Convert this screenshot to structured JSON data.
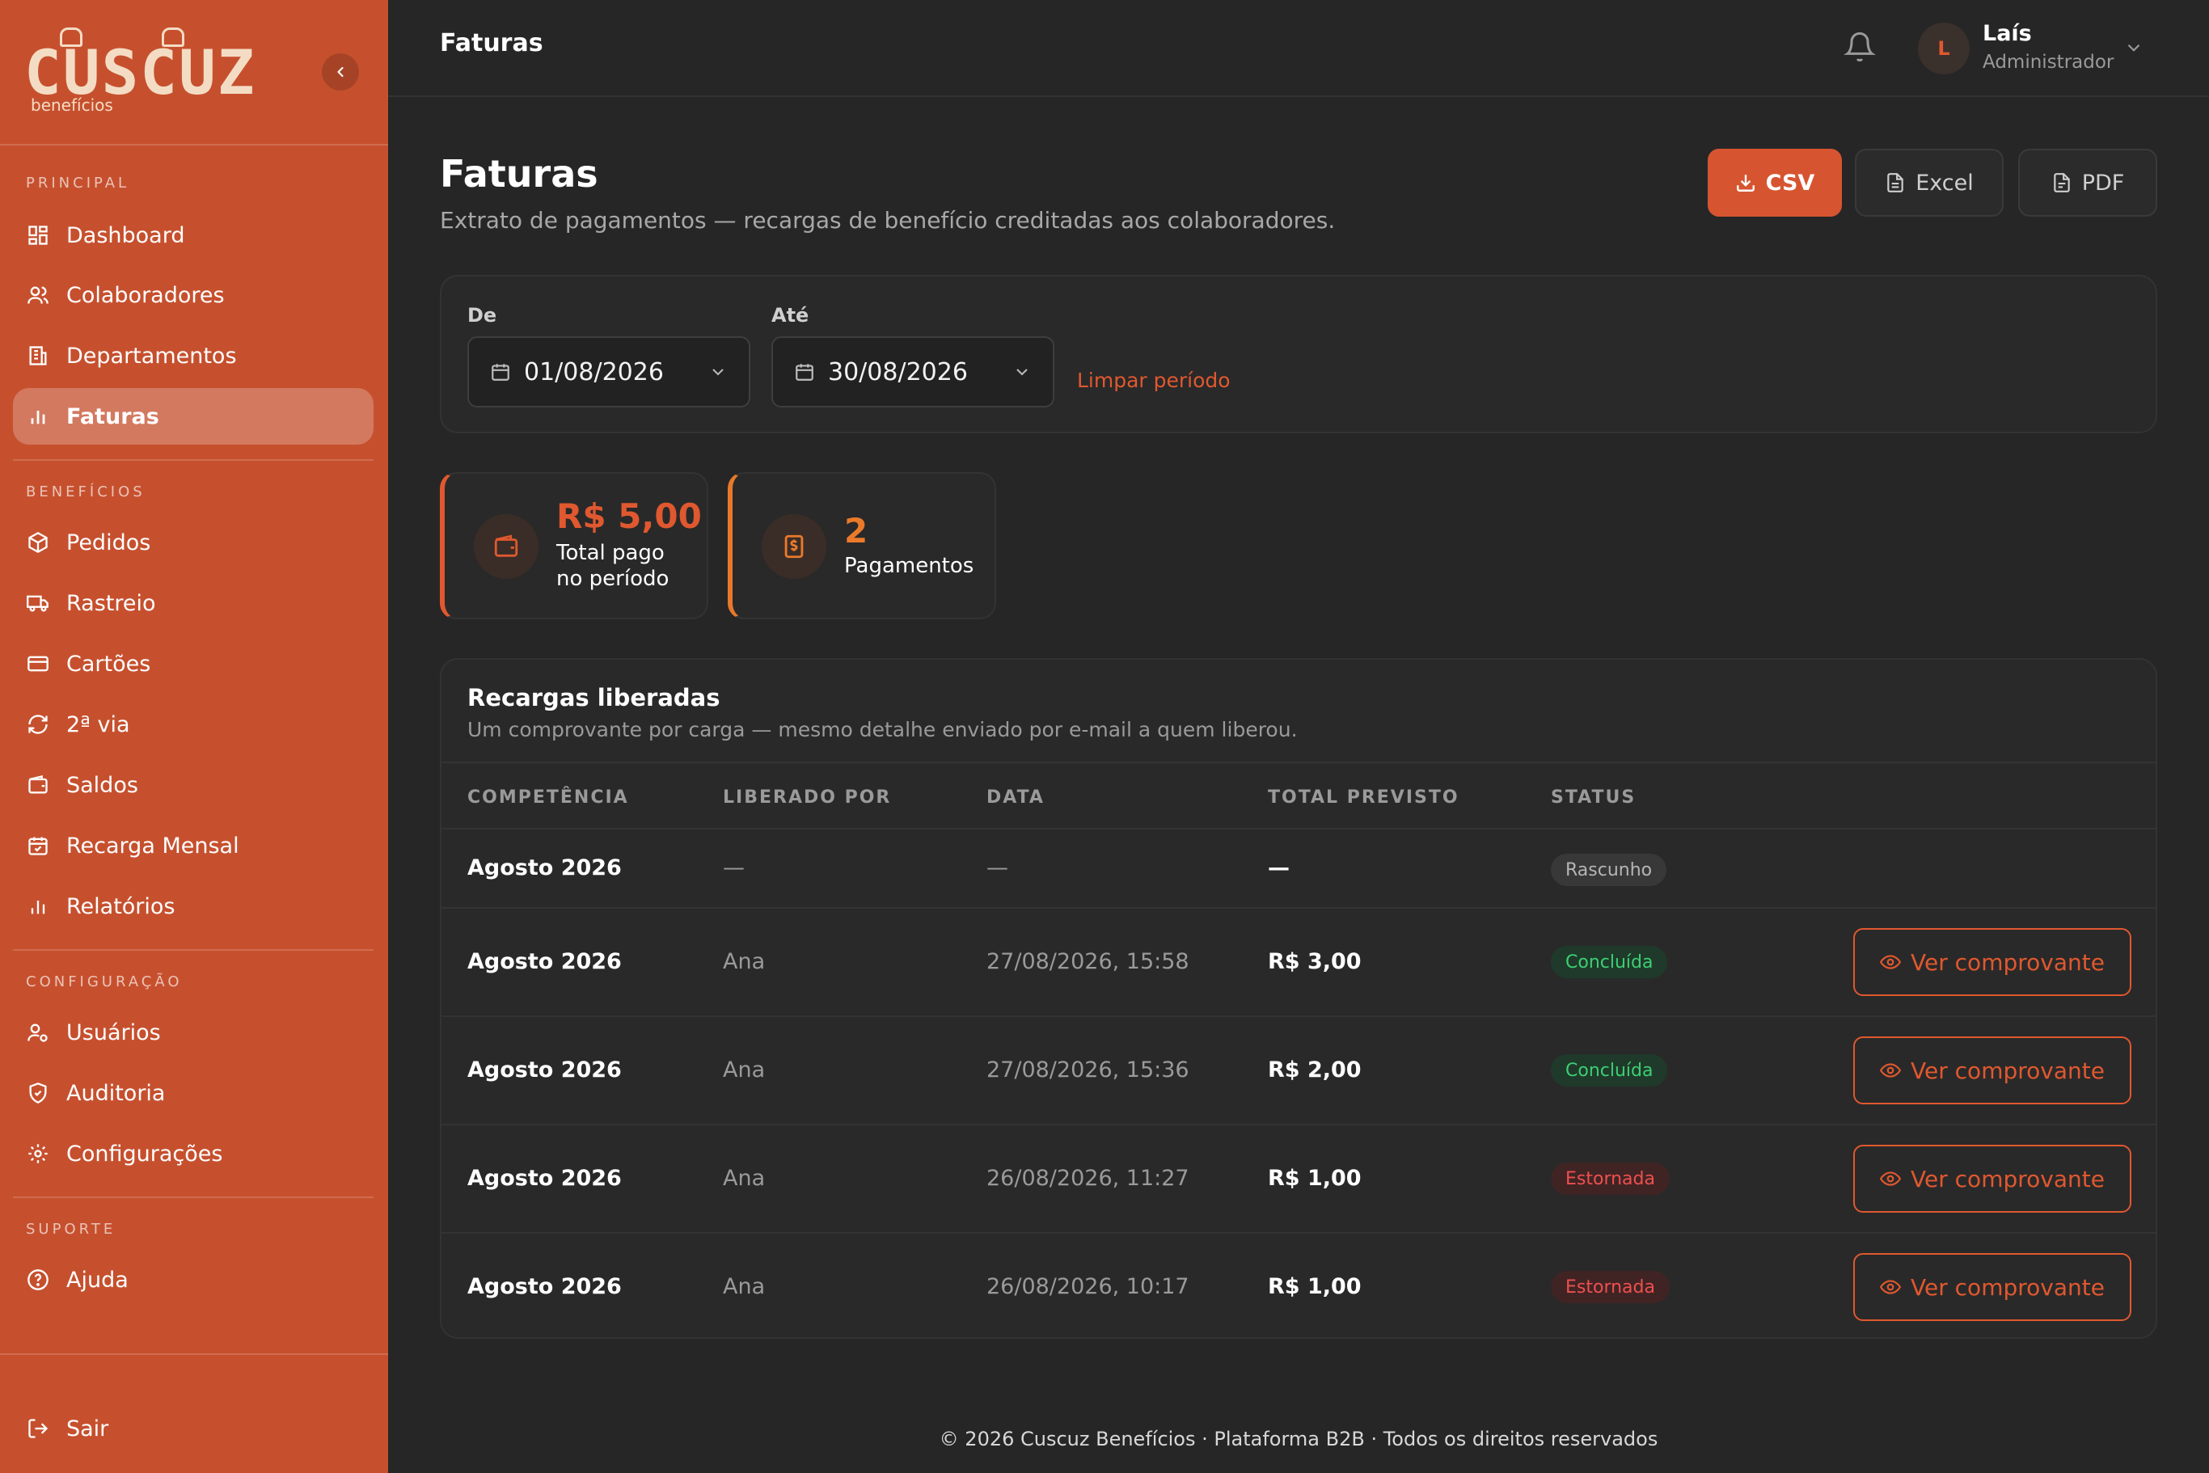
{
  "brand": {
    "name": "CUSCUZ",
    "tagline": "benefícios"
  },
  "colors": {
    "sidebar": "#c6502e",
    "accent": "#e0582f",
    "background": "#262626",
    "success": "#3ccf74",
    "danger": "#ef4f4f"
  },
  "sidebar": {
    "sections": {
      "principal": "PRINCIPAL",
      "beneficios": "BENEFÍCIOS",
      "configuracao": "CONFIGURAÇÃO",
      "suporte": "SUPORTE"
    },
    "items": {
      "dashboard": "Dashboard",
      "colaboradores": "Colaboradores",
      "departamentos": "Departamentos",
      "faturas": "Faturas",
      "pedidos": "Pedidos",
      "rastreio": "Rastreio",
      "cartoes": "Cartões",
      "segunda_via": "2ª via",
      "saldos": "Saldos",
      "recarga_mensal": "Recarga Mensal",
      "relatorios": "Relatórios",
      "usuarios": "Usuários",
      "auditoria": "Auditoria",
      "configuracoes": "Configurações",
      "ajuda": "Ajuda",
      "sair": "Sair"
    },
    "active_item": "faturas"
  },
  "topbar": {
    "title": "Faturas",
    "user": {
      "initial": "L",
      "name": "Laís",
      "role": "Administrador"
    }
  },
  "page": {
    "title": "Faturas",
    "subtitle": "Extrato de pagamentos — recargas de benefício creditadas aos colaboradores.",
    "export": {
      "csv": "CSV",
      "excel": "Excel",
      "pdf": "PDF"
    }
  },
  "filter": {
    "from_label": "De",
    "from_value": "01/08/2026",
    "to_label": "Até",
    "to_value": "30/08/2026",
    "clear_label": "Limpar período"
  },
  "stats": {
    "total": {
      "value": "R$ 5,00",
      "label_line1": "Total pago",
      "label_line2": "no período"
    },
    "count": {
      "value": "2",
      "label": "Pagamentos"
    }
  },
  "table": {
    "title": "Recargas liberadas",
    "subtitle": "Um comprovante por carga — mesmo detalhe enviado por e-mail a quem liberou.",
    "headers": {
      "competencia": "COMPETÊNCIA",
      "liberado_por": "LIBERADO POR",
      "data": "DATA",
      "total": "TOTAL PREVISTO",
      "status": "STATUS"
    },
    "action_label": "Ver comprovante",
    "rows": [
      {
        "competencia": "Agosto 2026",
        "liberado_por": "—",
        "data": "—",
        "total": "—",
        "status": "Rascunho"
      },
      {
        "competencia": "Agosto 2026",
        "liberado_por": "Ana",
        "data": "27/08/2026, 15:58",
        "total": "R$ 3,00",
        "status": "Concluída"
      },
      {
        "competencia": "Agosto 2026",
        "liberado_por": "Ana",
        "data": "27/08/2026, 15:36",
        "total": "R$ 2,00",
        "status": "Concluída"
      },
      {
        "competencia": "Agosto 2026",
        "liberado_por": "Ana",
        "data": "26/08/2026, 11:27",
        "total": "R$ 1,00",
        "status": "Estornada"
      },
      {
        "competencia": "Agosto 2026",
        "liberado_por": "Ana",
        "data": "26/08/2026, 10:17",
        "total": "R$ 1,00",
        "status": "Estornada"
      }
    ]
  },
  "footer": {
    "text": "© 2026 Cuscuz Benefícios · Plataforma B2B · Todos os direitos reservados"
  },
  "icons": [
    "chevron-left-icon",
    "dashboard-icon",
    "users-icon",
    "building-icon",
    "bar-chart-icon",
    "package-icon",
    "truck-icon",
    "card-icon",
    "refresh-icon",
    "wallet-icon",
    "calendar-icon",
    "bell-icon",
    "chevron-down-icon",
    "download-icon",
    "file-icon",
    "eye-icon",
    "user-cog-icon",
    "shield-icon",
    "gear-icon",
    "help-icon",
    "logout-icon",
    "dollar-icon"
  ]
}
